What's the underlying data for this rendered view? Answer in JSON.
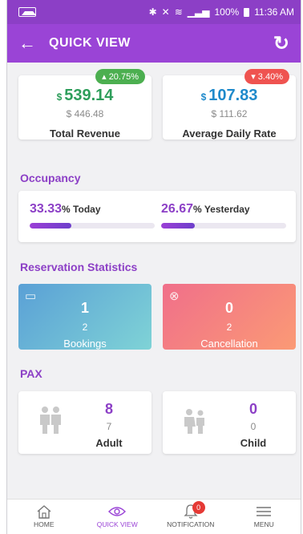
{
  "status_bar": {
    "time": "11:36 AM",
    "battery": "100%"
  },
  "appbar": {
    "title": "QUICK VIEW"
  },
  "revenue": {
    "total": {
      "currency": "$",
      "value": "539.14",
      "previous": "$ 446.48",
      "label": "Total Revenue",
      "change": "20.75%",
      "direction": "up",
      "color": "#2e9e5b"
    },
    "adr": {
      "currency": "$",
      "value": "107.83",
      "previous": "$ 111.62",
      "label": "Average Daily Rate",
      "change": "3.40%",
      "direction": "down",
      "color": "#1f8acb"
    }
  },
  "occupancy": {
    "title": "Occupancy",
    "today": {
      "value": "33.33",
      "unit": "% Today",
      "fraction": 0.3333
    },
    "yesterday": {
      "value": "26.67",
      "unit": "% Yesterday",
      "fraction": 0.2667
    }
  },
  "reservation": {
    "title": "Reservation Statistics",
    "bookings": {
      "count": "1",
      "secondary": "2",
      "label": "Bookings",
      "icon": "calendar-icon"
    },
    "cancellation": {
      "count": "0",
      "secondary": "2",
      "label": "Cancellation",
      "icon": "close-circle-icon"
    }
  },
  "pax": {
    "title": "PAX",
    "adult": {
      "count": "8",
      "secondary": "7",
      "label": "Adult",
      "icon": "adult-people-icon"
    },
    "child": {
      "count": "0",
      "secondary": "0",
      "label": "Child",
      "icon": "child-people-icon"
    }
  },
  "bottom_nav": {
    "items": [
      {
        "label": "HOME",
        "icon": "home-icon"
      },
      {
        "label": "QUICK VIEW",
        "icon": "eye-icon"
      },
      {
        "label": "NOTIFICATION",
        "icon": "bell-icon",
        "badge": "0"
      },
      {
        "label": "MENU",
        "icon": "menu-icon"
      }
    ]
  },
  "colors": {
    "primary": "#9a44d6",
    "up_badge": "#4caf50",
    "down_badge": "#ef5350",
    "bookings_gradient": [
      "#5aa0d6",
      "#7fd3d6"
    ],
    "cancel_gradient": [
      "#f06f8a",
      "#fb9a75"
    ]
  }
}
